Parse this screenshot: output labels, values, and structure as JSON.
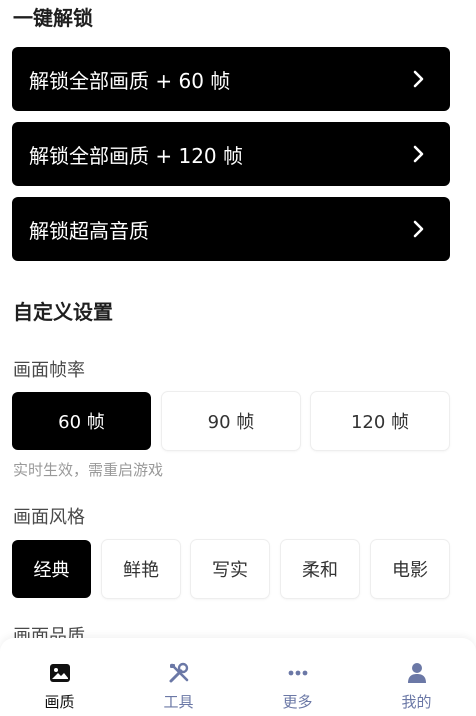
{
  "unlock": {
    "title": "一键解锁",
    "items": [
      {
        "label": "解锁全部画质 + 60 帧"
      },
      {
        "label": "解锁全部画质 + 120 帧"
      },
      {
        "label": "解锁超高音质"
      }
    ]
  },
  "custom": {
    "title": "自定义设置",
    "frame_rate": {
      "label": "画面帧率",
      "options": [
        "60 帧",
        "90 帧",
        "120 帧"
      ],
      "selected": "60 帧",
      "hint": "实时生效，需重启游戏"
    },
    "style": {
      "label": "画面风格",
      "options": [
        "经典",
        "鲜艳",
        "写实",
        "柔和",
        "电影"
      ],
      "selected": "经典"
    },
    "quality_label": "画面品质"
  },
  "nav": {
    "items": [
      {
        "label": "画质",
        "icon": "image-icon",
        "active": true
      },
      {
        "label": "工具",
        "icon": "tools-icon",
        "active": false
      },
      {
        "label": "更多",
        "icon": "more-icon",
        "active": false
      },
      {
        "label": "我的",
        "icon": "user-icon",
        "active": false
      }
    ]
  },
  "colors": {
    "accent": "#000000",
    "nav_inactive": "#6b78a6"
  }
}
